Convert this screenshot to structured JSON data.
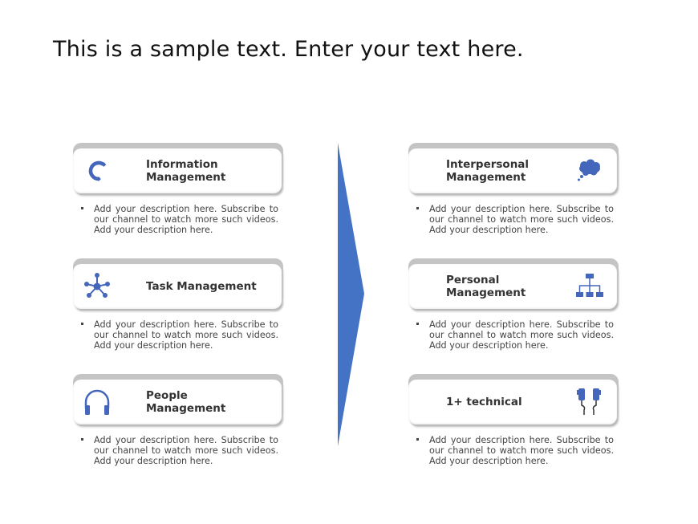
{
  "title": "This is a sample text. Enter your text here.",
  "colors": {
    "accent": "#4472C4",
    "icon": "#4466BB",
    "card_rim": "#C4C4C4",
    "text": "#333333"
  },
  "left_items": [
    {
      "label_line1": "Information",
      "label_line2": "Management",
      "icon": "magnet-icon",
      "description": "Add your description here. Subscribe to our channel to watch more such videos. Add your description here."
    },
    {
      "label_line1": "Task Management",
      "label_line2": "",
      "icon": "network-hub-icon",
      "description": "Add your description here. Subscribe to our channel to watch more such videos. Add your description here."
    },
    {
      "label_line1": "People",
      "label_line2": "Management",
      "icon": "headphones-icon",
      "description": "Add your description here. Subscribe to our channel to watch more such videos. Add your description here."
    }
  ],
  "right_items": [
    {
      "label_line1": "Interpersonal",
      "label_line2": "Management",
      "icon": "thought-cloud-icon",
      "description": "Add your description here. Subscribe to our channel to watch more such videos. Add your description here."
    },
    {
      "label_line1": "Personal",
      "label_line2": "Management",
      "icon": "org-chart-icon",
      "description": "Add your description here. Subscribe to our channel to watch more such videos. Add your description here."
    },
    {
      "label_line1": "1+ technical",
      "label_line2": "",
      "icon": "earphones-icon",
      "description": "Add your description here. Subscribe to our channel to watch more such videos. Add your description here."
    }
  ]
}
